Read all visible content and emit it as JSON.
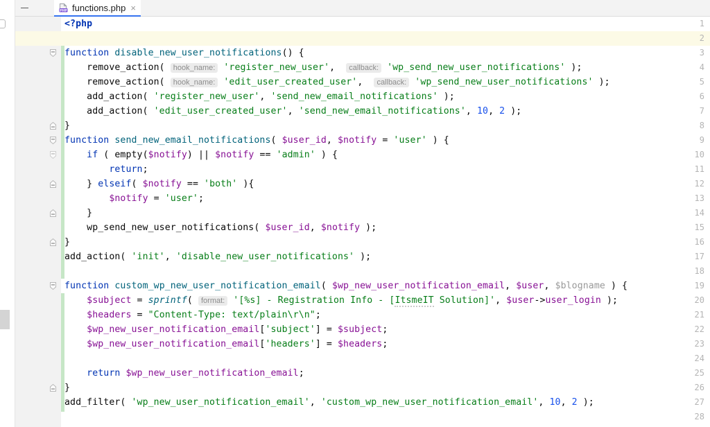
{
  "window": {
    "collapse_icon": "minimize-icon"
  },
  "tab": {
    "icon": "php-file-icon",
    "title": "functions.php",
    "close_label": "×"
  },
  "editor": {
    "caret_line": 2,
    "total_lines_visible": 28,
    "language": "PHP",
    "colors": {
      "keyword": "#0033b3",
      "string": "#067d17",
      "variable": "#871094",
      "function": "#00627a",
      "number": "#1750eb",
      "caret_line_bg": "#fcfae6",
      "change_bar": "#c6e6c6",
      "gutter_bg": "#f2f2f2",
      "tab_underline": "#3573f0"
    },
    "line_numbers": [
      1,
      2,
      3,
      4,
      5,
      6,
      7,
      8,
      9,
      10,
      11,
      12,
      13,
      14,
      15,
      16,
      17,
      18,
      19,
      20,
      21,
      22,
      23,
      24,
      25,
      26,
      27,
      28
    ],
    "lines": [
      {
        "n": 1,
        "text": "<?php"
      },
      {
        "n": 2,
        "text": ""
      },
      {
        "n": 3,
        "text": "function disable_new_user_notifications() {"
      },
      {
        "n": 4,
        "text": "    remove_action( hook_name: 'register_new_user', callback: 'wp_send_new_user_notifications' );"
      },
      {
        "n": 5,
        "text": "    remove_action( hook_name: 'edit_user_created_user', callback: 'wp_send_new_user_notifications' );"
      },
      {
        "n": 6,
        "text": "    add_action( 'register_new_user', 'send_new_email_notifications' );"
      },
      {
        "n": 7,
        "text": "    add_action( 'edit_user_created_user', 'send_new_email_notifications', 10, 2 );"
      },
      {
        "n": 8,
        "text": "}"
      },
      {
        "n": 9,
        "text": "function send_new_email_notifications( $user_id, $notify = 'user' ) {"
      },
      {
        "n": 10,
        "text": "    if ( empty($notify) || $notify == 'admin' ) {"
      },
      {
        "n": 11,
        "text": "        return;"
      },
      {
        "n": 12,
        "text": "    } elseif( $notify == 'both' ){"
      },
      {
        "n": 13,
        "text": "        $notify = 'user';"
      },
      {
        "n": 14,
        "text": "    }"
      },
      {
        "n": 15,
        "text": "    wp_send_new_user_notifications( $user_id, $notify );"
      },
      {
        "n": 16,
        "text": "}"
      },
      {
        "n": 17,
        "text": "add_action( 'init', 'disable_new_user_notifications' );"
      },
      {
        "n": 18,
        "text": ""
      },
      {
        "n": 19,
        "text": "function custom_wp_new_user_notification_email( $wp_new_user_notification_email, $user, $blogname ) {"
      },
      {
        "n": 20,
        "text": "    $subject = sprintf( format: '[%s] - Registration Info - [ItsmeIT Solution]', $user->user_login );"
      },
      {
        "n": 21,
        "text": "    $headers = \"Content-Type: text/plain\\r\\n\";"
      },
      {
        "n": 22,
        "text": "    $wp_new_user_notification_email['subject'] = $subject;"
      },
      {
        "n": 23,
        "text": "    $wp_new_user_notification_email['headers'] = $headers;"
      },
      {
        "n": 24,
        "text": ""
      },
      {
        "n": 25,
        "text": "    return $wp_new_user_notification_email;"
      },
      {
        "n": 26,
        "text": "}"
      },
      {
        "n": 27,
        "text": "add_filter( 'wp_new_user_notification_email', 'custom_wp_new_user_notification_email', 10, 2 );"
      },
      {
        "n": 28,
        "text": ""
      }
    ],
    "inlay_hints": [
      {
        "line": 4,
        "labels": [
          "hook_name:",
          "callback:"
        ]
      },
      {
        "line": 5,
        "labels": [
          "hook_name:",
          "callback:"
        ]
      },
      {
        "line": 20,
        "labels": [
          "format:"
        ]
      }
    ],
    "fold_markers": [
      {
        "line": 3,
        "state": "expanded"
      },
      {
        "line": 8,
        "state": "end"
      },
      {
        "line": 9,
        "state": "expanded"
      },
      {
        "line": 10,
        "state": "expanded"
      },
      {
        "line": 12,
        "state": "end"
      },
      {
        "line": 14,
        "state": "end"
      },
      {
        "line": 16,
        "state": "end"
      },
      {
        "line": 19,
        "state": "expanded"
      },
      {
        "line": 26,
        "state": "end"
      }
    ],
    "spellcheck_warnings": [
      "ItsmeIT"
    ]
  }
}
